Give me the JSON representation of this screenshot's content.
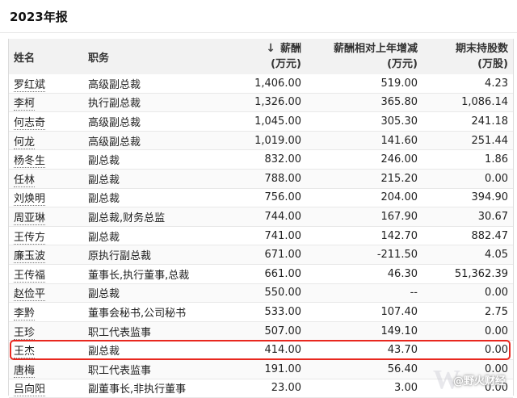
{
  "header": {
    "title": "2023年报"
  },
  "table": {
    "columns": {
      "name": "姓名",
      "role": "职务",
      "salary_l1": "薪酬",
      "salary_l2": "(万元)",
      "change_l1": "薪酬相对上年增减",
      "change_l2": "(万元)",
      "shares_l1": "期末持股数",
      "shares_l2": "(万股)"
    },
    "sort_icon": "arrow-down-icon",
    "sort_symbol": "↓",
    "rows": [
      {
        "name": "罗红斌",
        "role": "高级副总裁",
        "salary": "1,406.00",
        "change": "519.00",
        "shares": "4.23"
      },
      {
        "name": "李柯",
        "role": "执行副总裁",
        "salary": "1,326.00",
        "change": "365.80",
        "shares": "1,086.14"
      },
      {
        "name": "何志奇",
        "role": "高级副总裁",
        "salary": "1,045.00",
        "change": "305.30",
        "shares": "241.18"
      },
      {
        "name": "何龙",
        "role": "高级副总裁",
        "salary": "1,019.00",
        "change": "141.60",
        "shares": "251.44"
      },
      {
        "name": "杨冬生",
        "role": "副总裁",
        "salary": "832.00",
        "change": "246.00",
        "shares": "1.86"
      },
      {
        "name": "任林",
        "role": "副总裁",
        "salary": "788.00",
        "change": "215.20",
        "shares": "0.00"
      },
      {
        "name": "刘焕明",
        "role": "副总裁",
        "salary": "756.00",
        "change": "204.00",
        "shares": "394.90"
      },
      {
        "name": "周亚琳",
        "role": "副总裁,财务总监",
        "salary": "744.00",
        "change": "167.90",
        "shares": "30.67"
      },
      {
        "name": "王传方",
        "role": "副总裁",
        "salary": "741.00",
        "change": "142.70",
        "shares": "882.47"
      },
      {
        "name": "廉玉波",
        "role": "原执行副总裁",
        "salary": "671.00",
        "change": "-211.50",
        "shares": "4.05"
      },
      {
        "name": "王传福",
        "role": "董事长,执行董事,总裁",
        "salary": "661.00",
        "change": "46.30",
        "shares": "51,362.39"
      },
      {
        "name": "赵俭平",
        "role": "副总裁",
        "salary": "550.00",
        "change": "--",
        "shares": "0.00"
      },
      {
        "name": "李黔",
        "role": "董事会秘书,公司秘书",
        "salary": "533.00",
        "change": "107.40",
        "shares": "2.75"
      },
      {
        "name": "王珍",
        "role": "职工代表监事",
        "salary": "507.00",
        "change": "149.10",
        "shares": "0.00"
      },
      {
        "name": "王杰",
        "role": "副总裁",
        "salary": "414.00",
        "change": "43.70",
        "shares": "0.00"
      },
      {
        "name": "唐梅",
        "role": "职工代表监事",
        "salary": "191.00",
        "change": "56.40",
        "shares": "0.00"
      },
      {
        "name": "吕向阳",
        "role": "副董事长,非执行董事",
        "salary": "23.00",
        "change": "3.00",
        "shares": "0.00"
      }
    ]
  },
  "highlighted_row_name": "王杰",
  "highlight_color": "#e8281f",
  "watermark": {
    "text": "@野火财经"
  }
}
